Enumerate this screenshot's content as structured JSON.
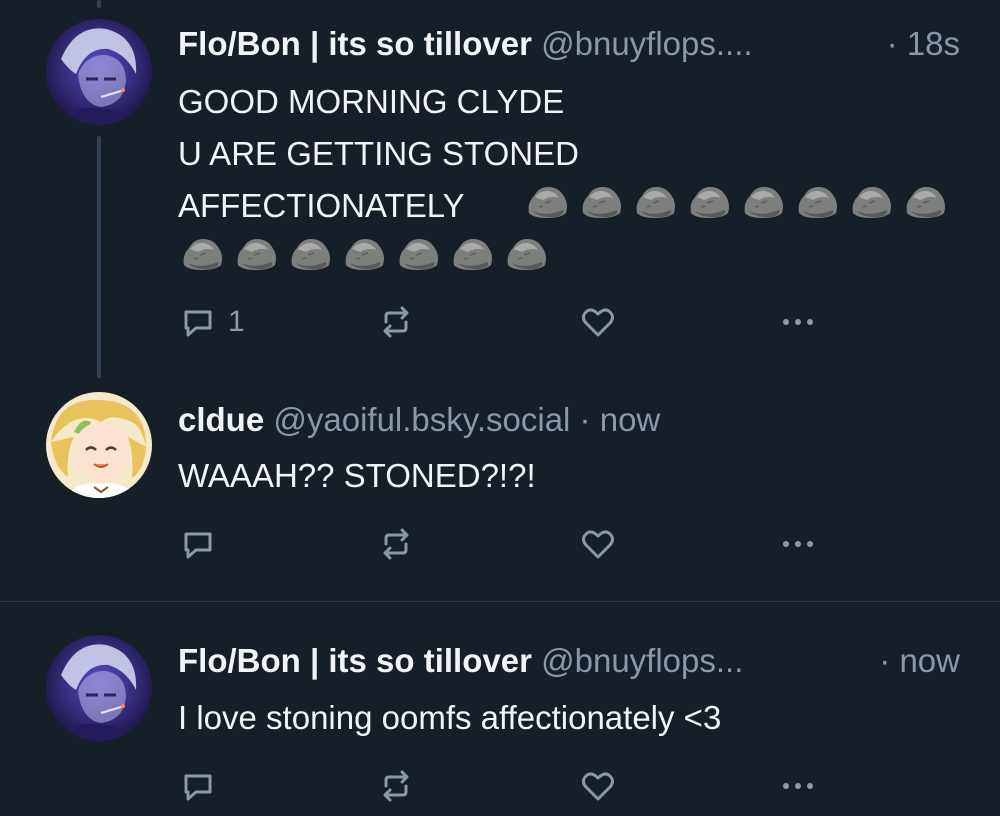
{
  "colors": {
    "background": "#161e27",
    "text_primary": "#f1f3f5",
    "text_secondary": "#8b98a9",
    "thread_line": "#324154"
  },
  "posts": [
    {
      "display_name": "Flo/Bon | its so tillover",
      "handle": "@bnuyflops....",
      "time": "18s",
      "text": "GOOD MORNING CLYDE\nU ARE GETTING STONED\nAFFECTIONATELY",
      "rock_emoji_count": 15,
      "reply_count": "1",
      "avatar_icon": "purple-haired-character-avatar"
    },
    {
      "display_name": "cldue",
      "handle": "@yaoiful.bsky.social",
      "time": "now",
      "text": "WAAAH?? STONED?!?!",
      "reply_count": "",
      "avatar_icon": "blonde-character-avatar"
    },
    {
      "display_name": "Flo/Bon | its so tillover",
      "handle": "@bnuyflops...",
      "time": "now",
      "text": "I love stoning oomfs affectionately <3",
      "reply_count": "",
      "avatar_icon": "purple-haired-character-avatar"
    }
  ],
  "action_icons": [
    "reply-icon",
    "repost-icon",
    "like-icon",
    "more-options-icon"
  ],
  "separator": "·"
}
